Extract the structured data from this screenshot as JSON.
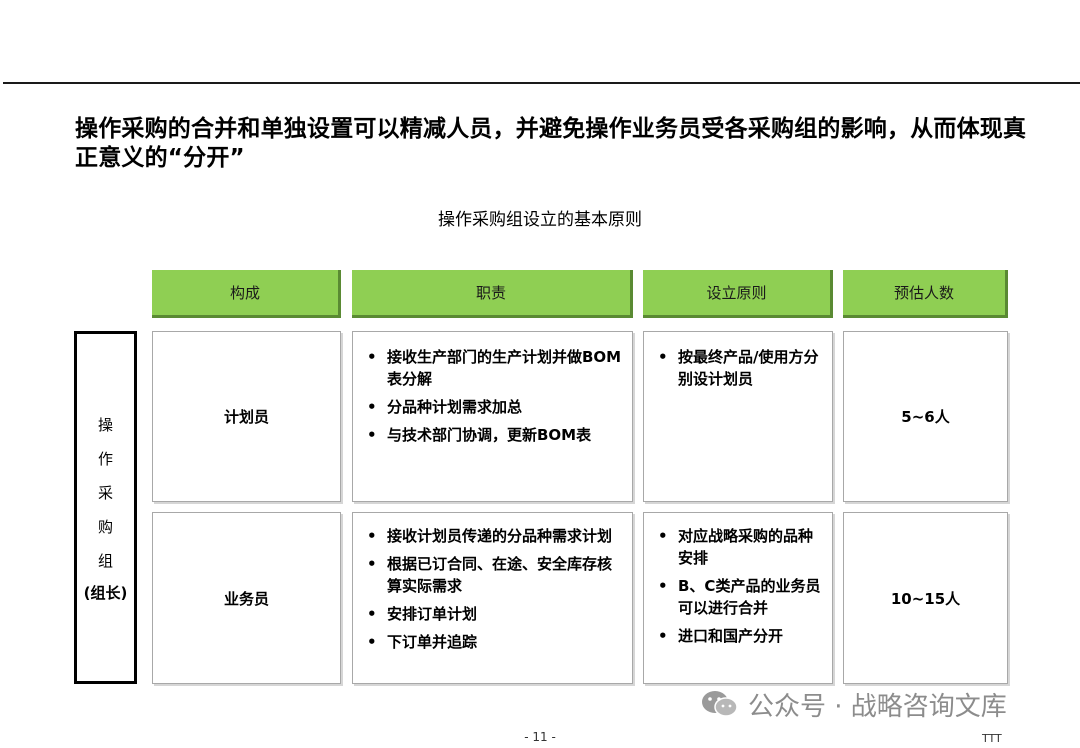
{
  "headline": "操作采购的合并和单独设置可以精减人员，并避免操作业务员受各采购组的影响，从而体现真正意义的“分开”",
  "subtitle": "操作采购组设立的基本原则",
  "header_color": "#8fcf53",
  "headers": [
    "构成",
    "职责",
    "设立原则",
    "预估人数"
  ],
  "group": {
    "chars": [
      "操",
      "作",
      "采",
      "购",
      "组"
    ],
    "sub": "(组长)"
  },
  "rows": [
    {
      "role": "计划员",
      "duties": [
        "接收生产部门的生产计划并做BOM表分解",
        "分品种计划需求加总",
        "与技术部门协调，更新BOM表"
      ],
      "principles": [
        "按最终产品/使用方分别设计划员"
      ],
      "headcount": "5~6人"
    },
    {
      "role": "业务员",
      "duties": [
        "接收计划员传递的分品种需求计划",
        "根据已订合同、在途、安全库存核算实际需求",
        "安排订单计划",
        "下订单并追踪"
      ],
      "principles": [
        "对应战略采购的品种安排",
        "B、C类产品的业务员可以进行合并",
        "进口和国产分开"
      ],
      "headcount": "10~15人"
    }
  ],
  "watermark": "公众号 · 战略咨询文库",
  "page_number": "- 11 -",
  "footer_mark": "TTT"
}
